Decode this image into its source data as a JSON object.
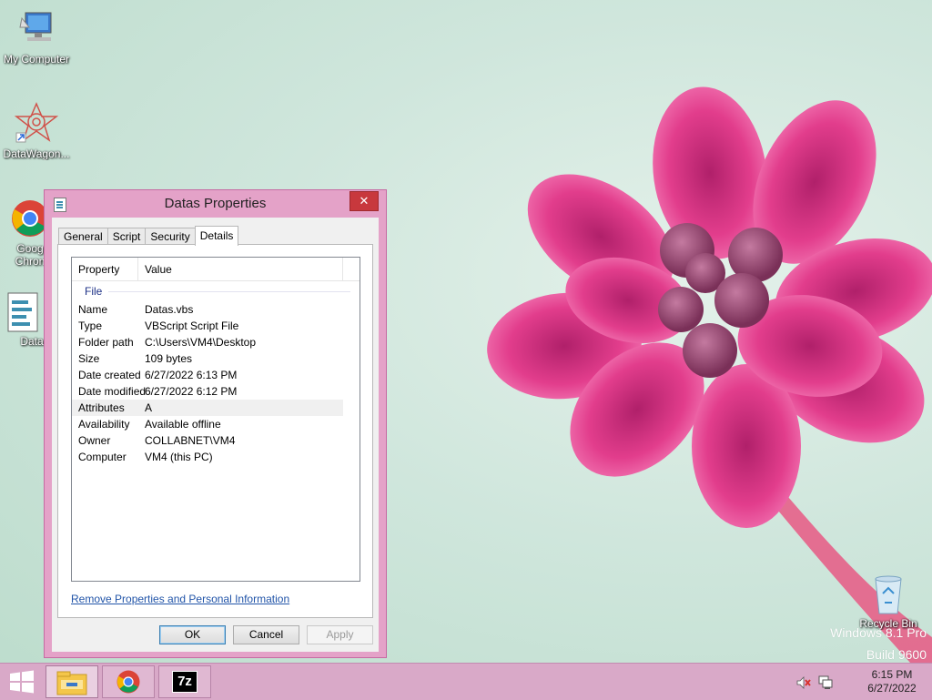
{
  "desktop": {
    "icons": [
      {
        "label": "My Computer"
      },
      {
        "label": "DataWagon..."
      },
      {
        "label": "Goog Chron"
      },
      {
        "label": "Data"
      },
      {
        "label": "Recycle Bin"
      }
    ],
    "watermark": {
      "line1": "Windows 8.1 Pro",
      "line2": "Build 9600"
    }
  },
  "dialog": {
    "title": "Datas Properties",
    "close_label": "✕",
    "tabs": [
      {
        "label": "General"
      },
      {
        "label": "Script"
      },
      {
        "label": "Security"
      },
      {
        "label": "Details",
        "active": true
      }
    ],
    "columns": {
      "property": "Property",
      "value": "Value"
    },
    "group": "File",
    "rows": [
      {
        "property": "Name",
        "value": "Datas.vbs"
      },
      {
        "property": "Type",
        "value": "VBScript Script File"
      },
      {
        "property": "Folder path",
        "value": "C:\\Users\\VM4\\Desktop"
      },
      {
        "property": "Size",
        "value": "109 bytes"
      },
      {
        "property": "Date created",
        "value": "6/27/2022 6:13 PM"
      },
      {
        "property": "Date modified",
        "value": "6/27/2022 6:12 PM"
      },
      {
        "property": "Attributes",
        "value": "A",
        "selected": true
      },
      {
        "property": "Availability",
        "value": "Available offline"
      },
      {
        "property": "Owner",
        "value": "COLLABNET\\VM4"
      },
      {
        "property": "Computer",
        "value": "VM4 (this PC)"
      }
    ],
    "remove_link": "Remove Properties and Personal Information",
    "buttons": {
      "ok": "OK",
      "cancel": "Cancel",
      "apply": "Apply"
    }
  },
  "taskbar": {
    "clock_time": "6:15 PM",
    "clock_date": "6/27/2022",
    "apps": [
      {
        "icon": "file-explorer-icon"
      },
      {
        "icon": "chrome-icon"
      },
      {
        "icon": "7zip-icon",
        "label": "7z"
      }
    ]
  },
  "colors": {
    "window_frame": "#e4a2c8",
    "taskbar": "#d9a9c8",
    "close": "#c8383d",
    "link": "#2154a8"
  }
}
